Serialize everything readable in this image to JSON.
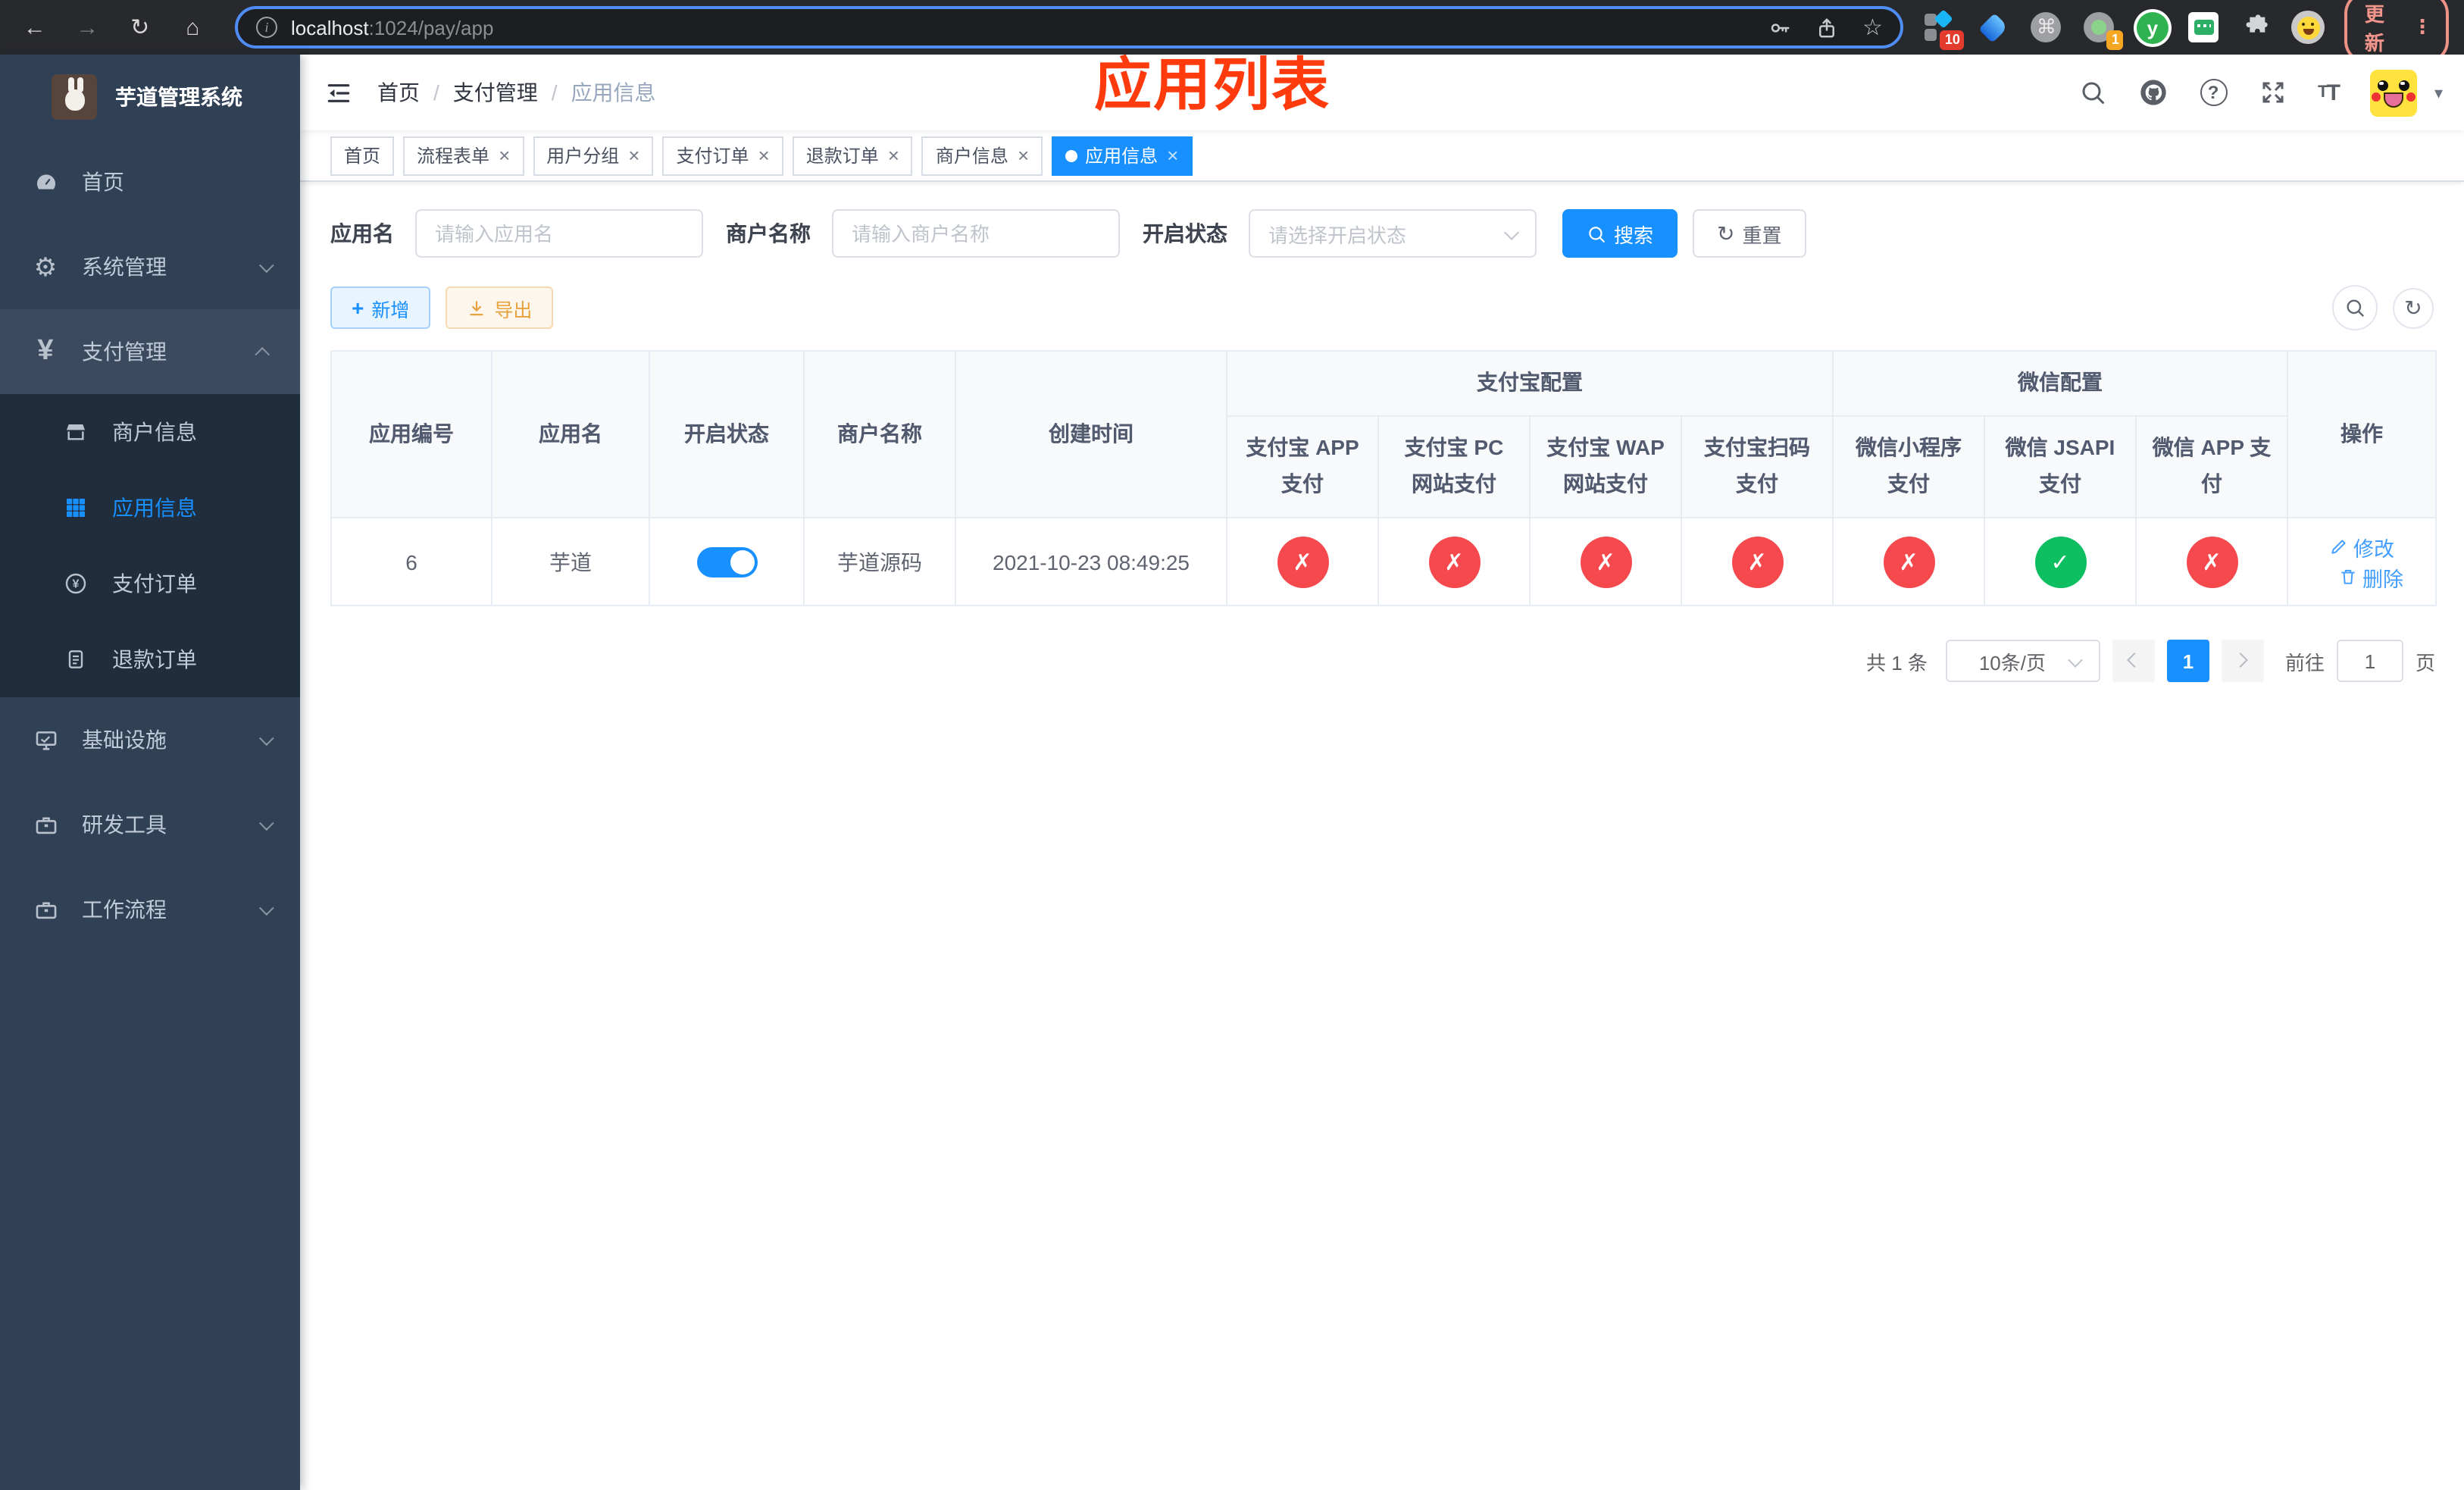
{
  "colors": {
    "primary": "#1890ff",
    "danger": "#f6494d",
    "success": "#0dbf61",
    "warning": "#e6a23c",
    "sidebar_bg": "#304156",
    "submenu_bg": "#1f2d3d",
    "annotation": "#ff3b0e"
  },
  "icons": {
    "back": "←",
    "forward": "→",
    "reload": "↻",
    "home": "⌂",
    "star": "☆",
    "command": "⌘",
    "dots": "⋮",
    "info": "i",
    "gear": "⚙",
    "yen": "¥",
    "question": "?",
    "close": "×",
    "caret": "▾",
    "plus": "+",
    "refresh": "↻",
    "font_big": "T",
    "font_small": "T",
    "ext_letter": "y"
  },
  "browser": {
    "url_host": "localhost",
    "url_path": ":1024/pay/app",
    "update_label": "更新",
    "ext_badge_tm": "10",
    "ext_badge_dot": "1"
  },
  "annotation": {
    "text": "应用列表"
  },
  "sidebar": {
    "title": "芋道管理系统",
    "items": [
      {
        "label": "首页",
        "active": false
      },
      {
        "label": "系统管理",
        "active": false
      },
      {
        "label": "支付管理",
        "active": false
      },
      {
        "label": "商户信息",
        "active": false
      },
      {
        "label": "应用信息",
        "active": true
      },
      {
        "label": "支付订单",
        "active": false
      },
      {
        "label": "退款订单",
        "active": false
      },
      {
        "label": "基础设施",
        "active": false
      },
      {
        "label": "研发工具",
        "active": false
      },
      {
        "label": "工作流程",
        "active": false
      }
    ]
  },
  "breadcrumb": {
    "items": [
      "首页",
      "支付管理",
      "应用信息"
    ]
  },
  "tabs": [
    {
      "label": "首页",
      "closable": false,
      "active": false
    },
    {
      "label": "流程表单",
      "closable": true,
      "active": false
    },
    {
      "label": "用户分组",
      "closable": true,
      "active": false
    },
    {
      "label": "支付订单",
      "closable": true,
      "active": false
    },
    {
      "label": "退款订单",
      "closable": true,
      "active": false
    },
    {
      "label": "商户信息",
      "closable": true,
      "active": false
    },
    {
      "label": "应用信息",
      "closable": true,
      "active": true
    }
  ],
  "filters": {
    "app_name_label": "应用名",
    "app_name_placeholder": "请输入应用名",
    "merchant_label": "商户名称",
    "merchant_placeholder": "请输入商户名称",
    "status_label": "开启状态",
    "status_placeholder": "请选择开启状态",
    "search_label": "搜索",
    "reset_label": "重置"
  },
  "toolbar": {
    "add_label": "新增",
    "export_label": "导出"
  },
  "table": {
    "headers": {
      "app_id": "应用编号",
      "app_name": "应用名",
      "status": "开启状态",
      "merchant": "商户名称",
      "created": "创建时间",
      "alipay_group": "支付宝配置",
      "wechat_group": "微信配置",
      "actions": "操作",
      "pay_columns": [
        "支付宝 APP 支付",
        "支付宝 PC 网站支付",
        "支付宝 WAP 网站支付",
        "支付宝扫码支付",
        "微信小程序支付",
        "微信 JSAPI 支付",
        "微信 APP 支付"
      ]
    },
    "row": {
      "app_id": "6",
      "app_name": "芋道",
      "enabled": true,
      "merchant": "芋道源码",
      "created": "2021-10-23 08:49:25",
      "pay_status": [
        false,
        false,
        false,
        false,
        false,
        true,
        false
      ],
      "edit_label": "修改",
      "delete_label": "删除"
    }
  },
  "pagination": {
    "total_text": "共 1 条",
    "page_size": "10条/页",
    "current_page": "1",
    "goto_label": "前往",
    "goto_value": "1",
    "page_unit": "页"
  }
}
